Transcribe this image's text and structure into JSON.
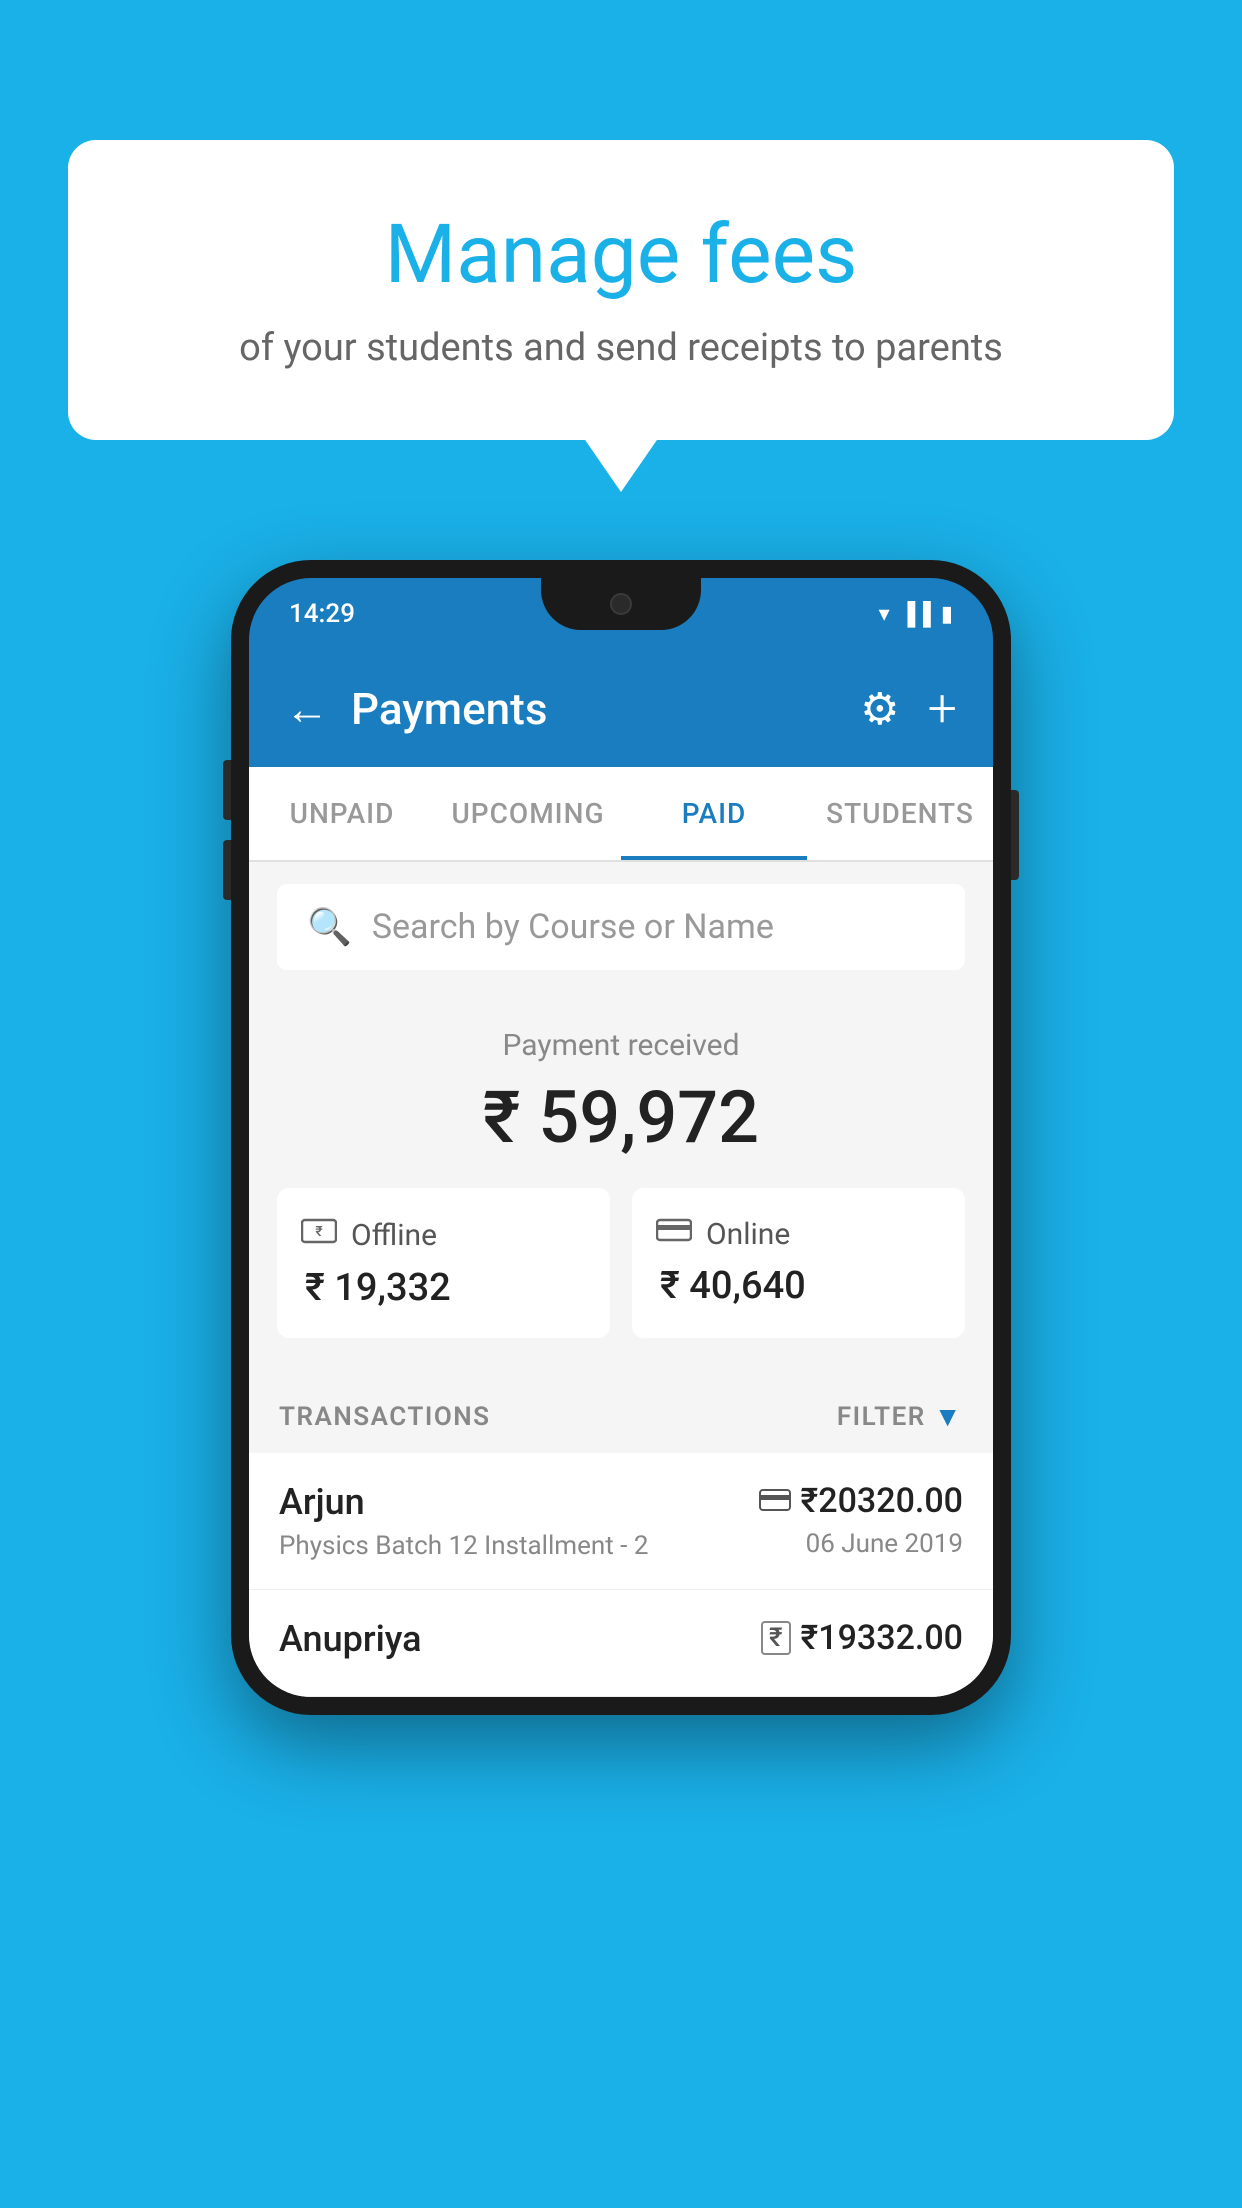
{
  "background_color": "#1ab0e8",
  "speech_bubble": {
    "title": "Manage fees",
    "subtitle": "of your students and send receipts to parents"
  },
  "phone": {
    "status_bar": {
      "time": "14:29"
    },
    "header": {
      "title": "Payments",
      "back_label": "←",
      "gear_label": "⚙",
      "plus_label": "+"
    },
    "tabs": [
      {
        "label": "UNPAID",
        "active": false
      },
      {
        "label": "UPCOMING",
        "active": false
      },
      {
        "label": "PAID",
        "active": true
      },
      {
        "label": "STUDENTS",
        "active": false
      }
    ],
    "search": {
      "placeholder": "Search by Course or Name"
    },
    "payment_summary": {
      "label": "Payment received",
      "amount": "₹ 59,972",
      "offline": {
        "label": "Offline",
        "amount": "₹ 19,332"
      },
      "online": {
        "label": "Online",
        "amount": "₹ 40,640"
      }
    },
    "transactions": {
      "header_label": "TRANSACTIONS",
      "filter_label": "FILTER",
      "items": [
        {
          "name": "Arjun",
          "detail": "Physics Batch 12 Installment - 2",
          "amount": "₹20320.00",
          "date": "06 June 2019",
          "payment_type": "card"
        },
        {
          "name": "Anupriya",
          "detail": "",
          "amount": "₹19332.00",
          "date": "",
          "payment_type": "cash"
        }
      ]
    }
  }
}
